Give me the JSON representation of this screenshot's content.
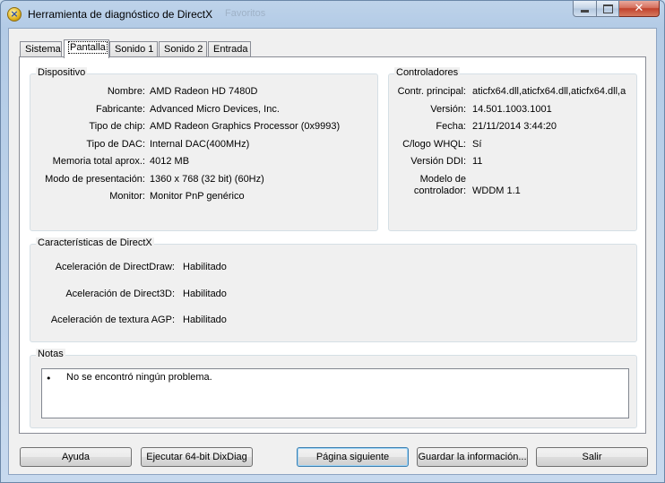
{
  "window": {
    "title": "Herramienta de diagnóstico de DirectX",
    "background_tab_title": "Favoritos"
  },
  "tabs": [
    {
      "label": "Sistema"
    },
    {
      "label": "Pantalla"
    },
    {
      "label": "Sonido 1"
    },
    {
      "label": "Sonido 2"
    },
    {
      "label": "Entrada"
    }
  ],
  "active_tab": "Pantalla",
  "device": {
    "title": "Dispositivo",
    "fields": [
      {
        "label": "Nombre:",
        "value": "AMD Radeon HD 7480D"
      },
      {
        "label": "Fabricante:",
        "value": "Advanced Micro Devices, Inc."
      },
      {
        "label": "Tipo de chip:",
        "value": "AMD Radeon Graphics Processor (0x9993)"
      },
      {
        "label": "Tipo de DAC:",
        "value": "Internal DAC(400MHz)"
      },
      {
        "label": "Memoria total aprox.:",
        "value": "4012 MB"
      },
      {
        "label": "Modo de presentación:",
        "value": "1360 x 768 (32 bit) (60Hz)"
      },
      {
        "label": "Monitor:",
        "value": "Monitor PnP genérico"
      }
    ]
  },
  "drivers": {
    "title": "Controladores",
    "fields": [
      {
        "label": "Contr. principal:",
        "value": "aticfx64.dll,aticfx64.dll,aticfx64.dll,a"
      },
      {
        "label": "Versión:",
        "value": "14.501.1003.1001"
      },
      {
        "label": "Fecha:",
        "value": "21/11/2014 3:44:20"
      },
      {
        "label": "C/logo WHQL:",
        "value": "Sí"
      },
      {
        "label": "Versión DDI:",
        "value": "11"
      },
      {
        "label_line1": "Modelo de",
        "label_line2": "controlador:",
        "value": "WDDM 1.1"
      }
    ]
  },
  "features": {
    "title": "Características de DirectX",
    "fields": [
      {
        "label": "Aceleración de DirectDraw:",
        "value": "Habilitado"
      },
      {
        "label": "Aceleración de Direct3D:",
        "value": "Habilitado"
      },
      {
        "label": "Aceleración de textura AGP:",
        "value": "Habilitado"
      }
    ]
  },
  "notes": {
    "title": "Notas",
    "items": [
      "No se encontró ningún problema."
    ]
  },
  "buttons": {
    "help": "Ayuda",
    "run64": "Ejecutar 64-bit DixDiag",
    "next_page": "Página siguiente",
    "save_info": "Guardar la información...",
    "exit": "Salir"
  }
}
